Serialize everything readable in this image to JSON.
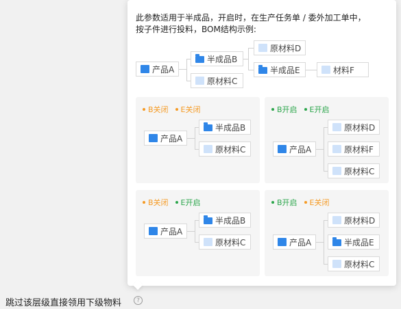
{
  "tooltip": {
    "line1": "此参数适用于半成品，开启时，在生产任务单 / 委外加工单中，",
    "line2": "按子件进行投料，BOM结构示例:"
  },
  "example": {
    "product_a": "产品A",
    "semi_b": "半成品B",
    "mat_c": "原材料C",
    "mat_d": "原材料D",
    "semi_e": "半成品E",
    "mat_f": "材料F"
  },
  "panels": [
    {
      "tag1": "B关闭",
      "tag2": "E关闭",
      "nodes": [
        "产品A",
        "半成品B",
        "原材料C"
      ]
    },
    {
      "tag1": "B开启",
      "tag2": "E开启",
      "nodes": [
        "产品A",
        "原材料D",
        "原材料F",
        "原材料C"
      ]
    },
    {
      "tag1": "B关闭",
      "tag2": "E开启",
      "nodes": [
        "产品A",
        "半成品B",
        "原材料C"
      ]
    },
    {
      "tag1": "B开启",
      "tag2": "E关闭",
      "nodes": [
        "产品A",
        "原材料D",
        "半成品E",
        "原材料C"
      ]
    }
  ],
  "setting": {
    "label": "跳过该层级直接领用下级物料",
    "help_icon": "?"
  },
  "colors": {
    "switch_off": "#f59a23",
    "switch_on": "#2aa54a",
    "product_icon": "#2f86e8",
    "material_icon": "#cfe2fa"
  },
  "icons": {
    "product": "square-icon",
    "semi": "folder-icon",
    "material": "light-square-icon",
    "help": "question-circle-icon"
  }
}
